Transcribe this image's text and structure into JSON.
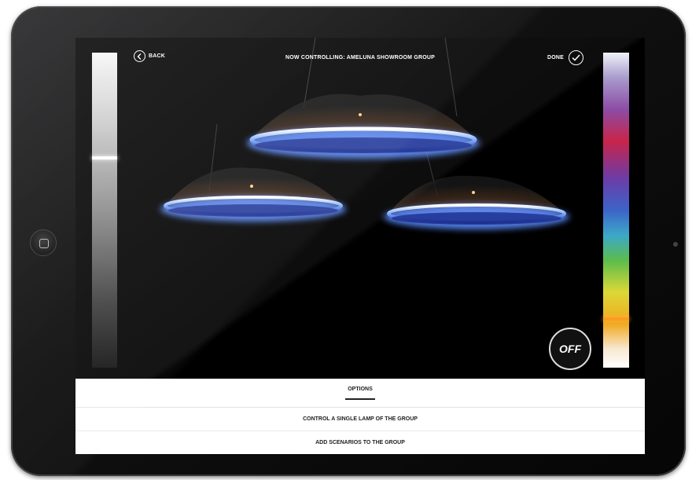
{
  "topbar": {
    "back_label": "BACK",
    "title": "NOW CONTROLLING: AMELUNA SHOWROOM GROUP",
    "done_label": "DONE"
  },
  "controls": {
    "off_label": "OFF",
    "brightness_level": 0.67,
    "color_position": 0.84
  },
  "options": {
    "header": "OPTIONS",
    "items": [
      {
        "label": "CONTROL A SINGLE LAMP OF THE GROUP"
      },
      {
        "label": "ADD SCENARIOS TO THE GROUP"
      }
    ]
  },
  "icons": {
    "back": "chevron-left-circle-icon",
    "done": "check-circle-icon",
    "home": "home-button-icon"
  },
  "colors": {
    "screen_background": "#000000",
    "lamp_glow": "#5a8cff",
    "color_handle": "#ff9a20"
  }
}
